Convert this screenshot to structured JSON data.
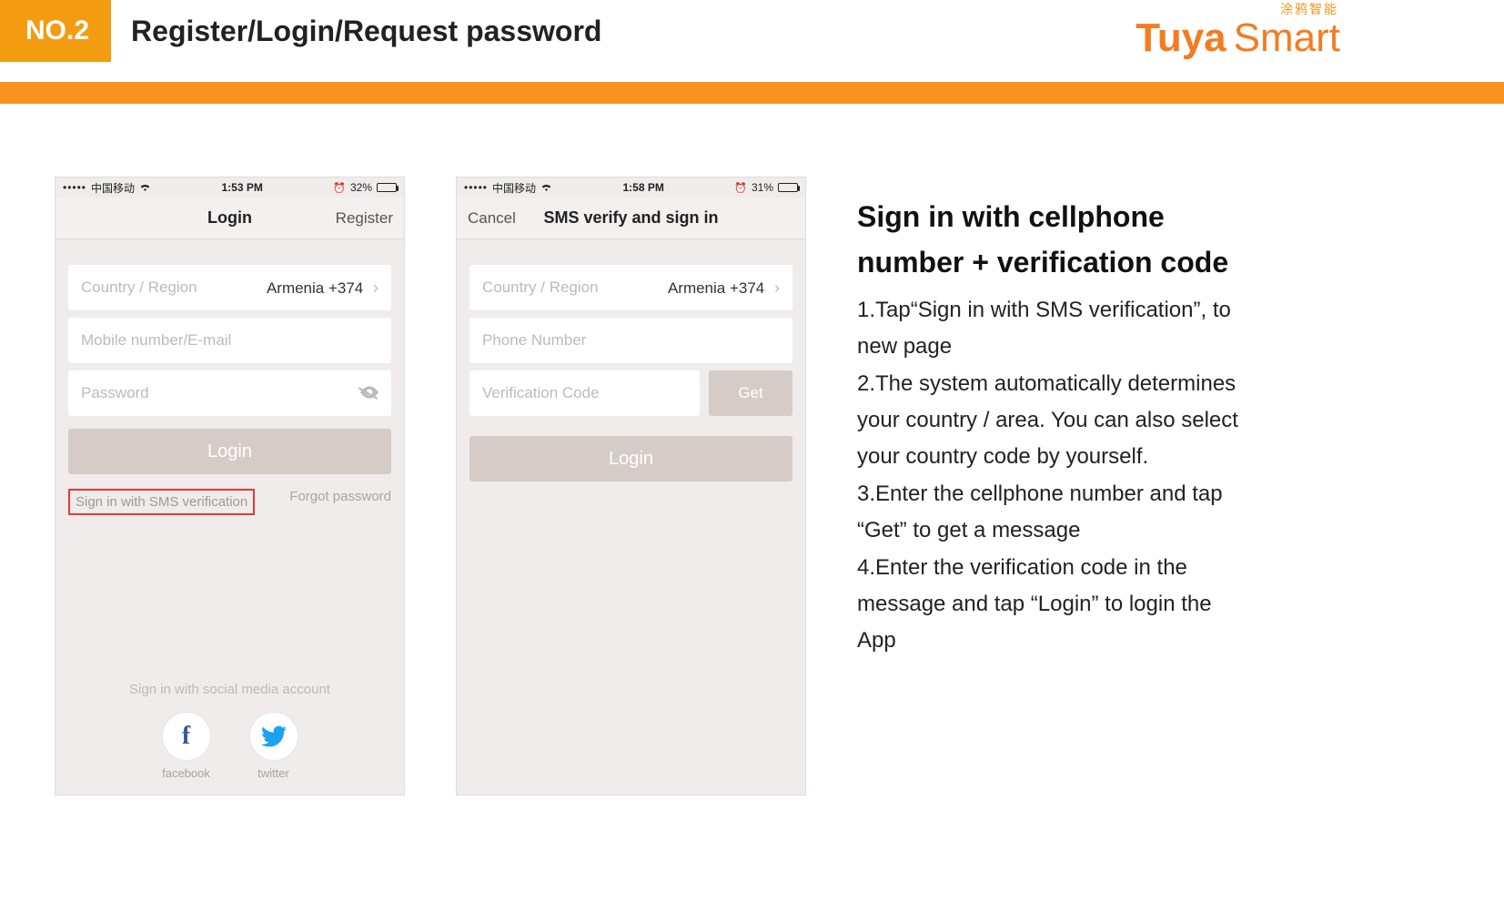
{
  "header": {
    "badge": "NO.2",
    "title": "Register/Login/Request password",
    "brand_cn": "涂鸦智能",
    "brand_en_bold": "Tuya",
    "brand_en_light": "Smart"
  },
  "screen1": {
    "status": {
      "dots": "•••••",
      "carrier": "中国移动",
      "wifi": "⌂",
      "time": "1:53 PM",
      "alarm": "⏰",
      "battery_pct": "32%"
    },
    "nav": {
      "left": "",
      "center": "Login",
      "right": "Register"
    },
    "fields": {
      "region_label": "Country / Region",
      "region_value": "Armenia +374",
      "login_placeholder": "Mobile number/E-mail",
      "password_placeholder": "Password"
    },
    "login_btn": "Login",
    "link_sms": "Sign in with SMS verification",
    "link_forgot": "Forgot password",
    "social_caption": "Sign in with social media account",
    "social": {
      "facebook": "facebook",
      "twitter": "twitter"
    }
  },
  "screen2": {
    "status": {
      "dots": "•••••",
      "carrier": "中国移动",
      "wifi": "⌂",
      "time": "1:58 PM",
      "alarm": "⏰",
      "battery_pct": "31%"
    },
    "nav": {
      "left": "Cancel",
      "center": "SMS verify and sign in",
      "right": ""
    },
    "fields": {
      "region_label": "Country / Region",
      "region_value": "Armenia +374",
      "phone_placeholder": "Phone Number",
      "code_placeholder": "Verification Code"
    },
    "get_btn": "Get",
    "login_btn": "Login"
  },
  "instructions": {
    "heading": "Sign in with cellphone number + verification code",
    "steps": [
      "1.Tap“Sign in with SMS verification”,  to new page",
      "2.The system automatically determines your country / area. You can also select your country code by yourself.",
      "3.Enter the cellphone number and tap “Get” to get a message",
      "4.Enter the verification code in the message and tap “Login” to login the App"
    ]
  }
}
